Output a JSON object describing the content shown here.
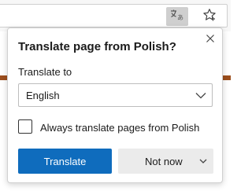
{
  "popup": {
    "title": "Translate page from Polish?",
    "translate_to_label": "Translate to",
    "target_language": "English",
    "always_translate_label": "Always translate pages from Polish",
    "always_translate_checked": false,
    "translate_button": "Translate",
    "not_now_button": "Not now"
  },
  "toolbar": {
    "translate_icon": "translate-icon",
    "favorite_icon": "star-icon"
  },
  "colors": {
    "accent": "#0f6cbd",
    "secondary_button": "#ebebeb",
    "page_strip": "#9c4e1d"
  }
}
